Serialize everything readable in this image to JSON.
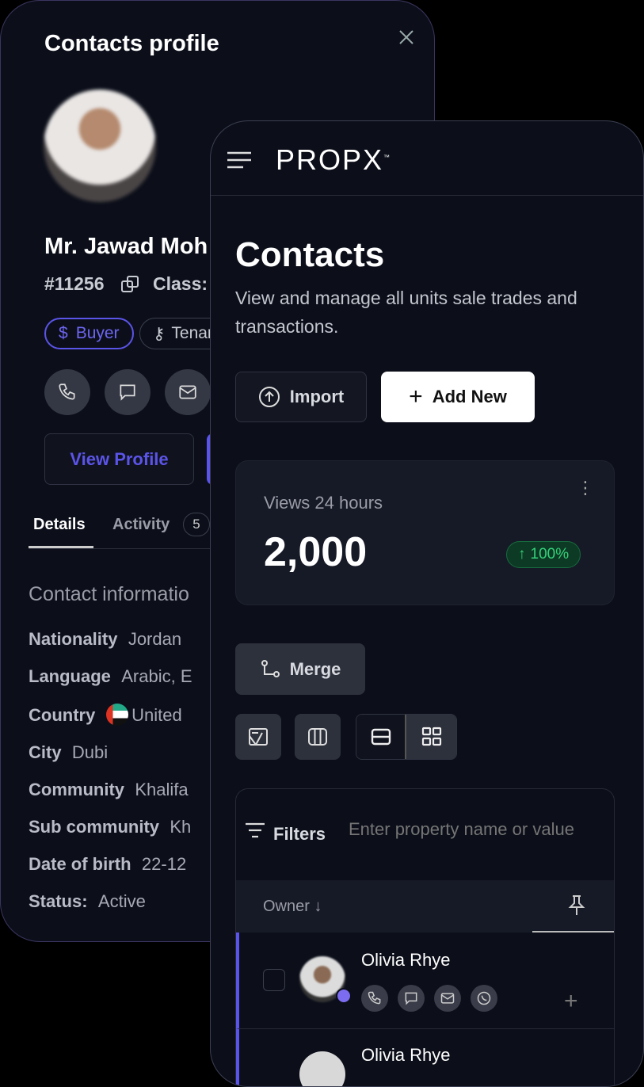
{
  "profile": {
    "title": "Contacts profile",
    "name": "Mr. Jawad Moh",
    "id": "#11256",
    "class_label": "Class:",
    "tags": [
      {
        "label": "Buyer",
        "icon": "dollar-icon"
      },
      {
        "label": "Tenar",
        "icon": "key-icon"
      }
    ],
    "view_profile": "View Profile",
    "tabs": [
      {
        "label": "Details"
      },
      {
        "label": "Activity",
        "badge": "5"
      }
    ],
    "section_title": "Contact informatio",
    "details": [
      {
        "label": "Nationality",
        "value": "Jordan"
      },
      {
        "label": "Language",
        "value": "Arabic, E"
      },
      {
        "label": "Country",
        "value": "United"
      },
      {
        "label": "City",
        "value": "Dubi"
      },
      {
        "label": "Community",
        "value": "Khalifa"
      },
      {
        "label": "Sub community",
        "value": "Kh"
      },
      {
        "label": "Date of birth",
        "value": "22-12"
      },
      {
        "label": "Status:",
        "value": "Active"
      }
    ]
  },
  "app": {
    "logo": "PROPX",
    "logo_tm": "™",
    "title": "Contacts",
    "subtitle": "View and manage all units sale trades and transactions.",
    "import": "Import",
    "add_new": "Add New",
    "stat": {
      "label": "Views 24 hours",
      "value": "2,000",
      "change": "100%",
      "change_color": "#22c55e"
    },
    "merge": "Merge",
    "filters": "Filters",
    "filter_placeholder": "Enter property name or value",
    "column_owner": "Owner",
    "rows": [
      {
        "name": "Olivia Rhye"
      },
      {
        "name": "Olivia Rhye"
      }
    ]
  },
  "colors": {
    "accent": "#5b54e8",
    "bg": "#0c0f1a"
  }
}
